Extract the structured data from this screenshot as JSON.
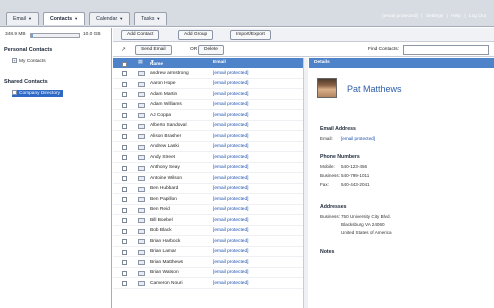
{
  "tabs": [
    {
      "label": "Email",
      "active": false
    },
    {
      "label": "Contacts",
      "active": true
    },
    {
      "label": "Calendar",
      "active": false
    },
    {
      "label": "Tasks",
      "active": false
    }
  ],
  "user": {
    "email": "[email protected]",
    "links": [
      "Settings",
      "Help",
      "Log Out"
    ],
    "sep": "|"
  },
  "quota": {
    "used": "348.9 MB",
    "total": "10.0 GB",
    "fraction": 0.035
  },
  "sidebar": {
    "personal_title": "Personal Contacts",
    "personal_items": [
      {
        "label": "My Contacts"
      }
    ],
    "shared_title": "Shared Contacts",
    "shared_items": [
      {
        "label": "Company Directory"
      }
    ]
  },
  "toolbar": {
    "add_contact": "Add Contact",
    "add_group": "Add Group",
    "import_export": "Import/Export"
  },
  "toolbar2": {
    "send_email": "Send Email",
    "of": "OR",
    "delete": "Delete",
    "find_label": "Find Contacts:",
    "find_value": ""
  },
  "list": {
    "col_name": "Name",
    "col_email": "Email",
    "rows": [
      {
        "name": "andrew armstrong",
        "email": "[email protected]"
      },
      {
        "name": "Aaron Hope",
        "email": "[email protected]"
      },
      {
        "name": "Adam Martin",
        "email": "[email protected]"
      },
      {
        "name": "Adam Williams",
        "email": "[email protected]"
      },
      {
        "name": "AJ Coppa",
        "email": "[email protected]"
      },
      {
        "name": "Alberto Sandoval",
        "email": "[email protected]"
      },
      {
        "name": "Alison Brasher",
        "email": "[email protected]"
      },
      {
        "name": "Andrew Laski",
        "email": "[email protected]"
      },
      {
        "name": "Andy Street",
        "email": "[email protected]"
      },
      {
        "name": "Anthony Seay",
        "email": "[email protected]"
      },
      {
        "name": "Antoine Wilson",
        "email": "[email protected]"
      },
      {
        "name": "Ben Hubbard",
        "email": "[email protected]"
      },
      {
        "name": "Ben Papillon",
        "email": "[email protected]"
      },
      {
        "name": "Ben Reid",
        "email": "[email protected]"
      },
      {
        "name": "Bill Boebel",
        "email": "[email protected]"
      },
      {
        "name": "Bob Black",
        "email": "[email protected]"
      },
      {
        "name": "Brian Harbock",
        "email": "[email protected]"
      },
      {
        "name": "Brian Lamar",
        "email": "[email protected]"
      },
      {
        "name": "Brian Matthews",
        "email": "[email protected]"
      },
      {
        "name": "Brian Watson",
        "email": "[email protected]"
      },
      {
        "name": "Cameron Nouri",
        "email": "[email protected]"
      }
    ]
  },
  "details": {
    "header": "Details",
    "name": "Pat Matthews",
    "email_title": "Email Address",
    "email_key": "Email:",
    "email_value": "[email protected]",
    "phone_title": "Phone Numbers",
    "phones": [
      {
        "k": "Mobile:",
        "v": "540-123-456"
      },
      {
        "k": "Business:",
        "v": "540-799-1011"
      },
      {
        "k": "Fax:",
        "v": "540-443-2041"
      }
    ],
    "addr_title": "Addresses",
    "addr_key": "Business:",
    "addr_lines": [
      "750 University City Blvd.",
      "Blacksburg VA 24060",
      "United States of America"
    ],
    "notes_title": "Notes"
  }
}
